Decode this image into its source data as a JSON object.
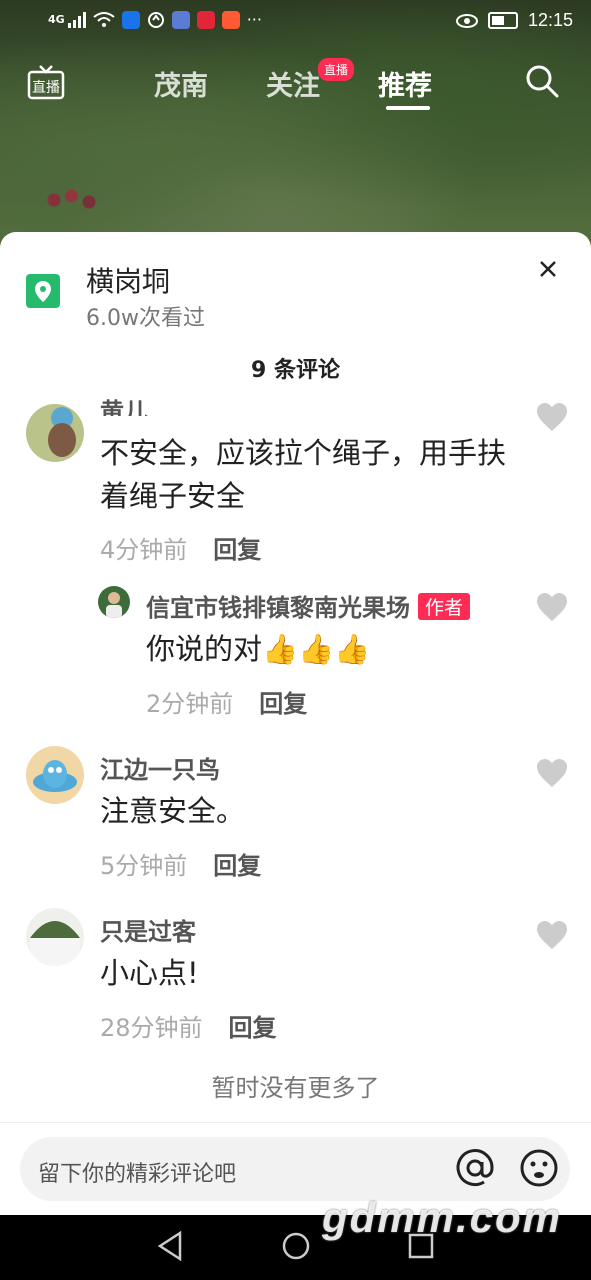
{
  "status_bar": {
    "network": "4G",
    "time": "12:15"
  },
  "top_nav": {
    "tabs": [
      {
        "label": "茂南"
      },
      {
        "label": "关注"
      },
      {
        "label": "推荐"
      }
    ],
    "live_badge": "直播",
    "live_icon_label": "直播"
  },
  "location": {
    "name": "横岗垌",
    "views": "6.0w次看过"
  },
  "comments_count": "9 条评论",
  "comments": [
    {
      "author": "黄儿",
      "text": "不安全，应该拉个绳子，用手扶着绳子安全",
      "time": "4分钟前",
      "reply_label": "回复"
    },
    {
      "author": "信宜市钱排镇黎南光果场",
      "author_tag": "作者",
      "text": "你说的对👍👍👍",
      "time": "2分钟前",
      "reply_label": "回复"
    },
    {
      "author": "江边一只鸟",
      "text": "注意安全。",
      "time": "5分钟前",
      "reply_label": "回复"
    },
    {
      "author": "只是过客",
      "text": "小心点!",
      "time": "28分钟前",
      "reply_label": "回复"
    }
  ],
  "no_more_text": "暂时没有更多了",
  "input": {
    "placeholder": "留下你的精彩评论吧"
  },
  "watermark": "gdmm.com",
  "colors": {
    "accent": "#fe2c55",
    "location_green": "#26bb6c"
  }
}
